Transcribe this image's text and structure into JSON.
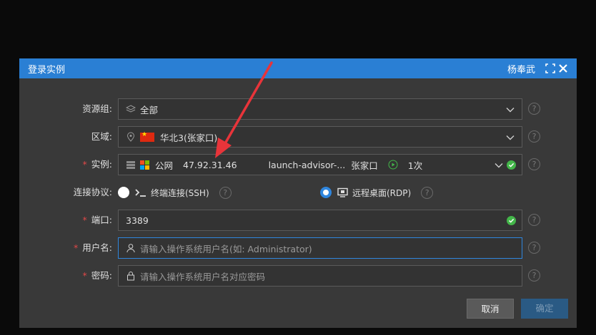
{
  "dialog": {
    "title": "登录实例",
    "user": "杨奉武"
  },
  "form": {
    "resource_group": {
      "label": "资源组:",
      "value": "全部"
    },
    "region": {
      "label": "区域:",
      "value": "华北3(张家口)"
    },
    "instance": {
      "label": "实例:",
      "network": "公网",
      "ip": "47.92.31.46",
      "name": "launch-advisor-...",
      "city": "张家口",
      "count": "1次"
    },
    "protocol": {
      "label": "连接协议:",
      "ssh_label": "终端连接(SSH)",
      "rdp_label": "远程桌面(RDP)",
      "selected": "rdp"
    },
    "port": {
      "label": "端口:",
      "value": "3389"
    },
    "username": {
      "label": "用户名:",
      "placeholder": "请输入操作系统用户名(如: Administrator)"
    },
    "password": {
      "label": "密码:",
      "placeholder": "请输入操作系统用户名对应密码"
    },
    "required_mark": "*",
    "help_glyph": "?"
  },
  "buttons": {
    "cancel": "取消",
    "ok": "确定"
  },
  "colors": {
    "titlebar": "#2a7fd4",
    "accent": "#2f86de",
    "success": "#43b649",
    "required": "#e04848",
    "annotation_arrow": "#e8343a"
  }
}
